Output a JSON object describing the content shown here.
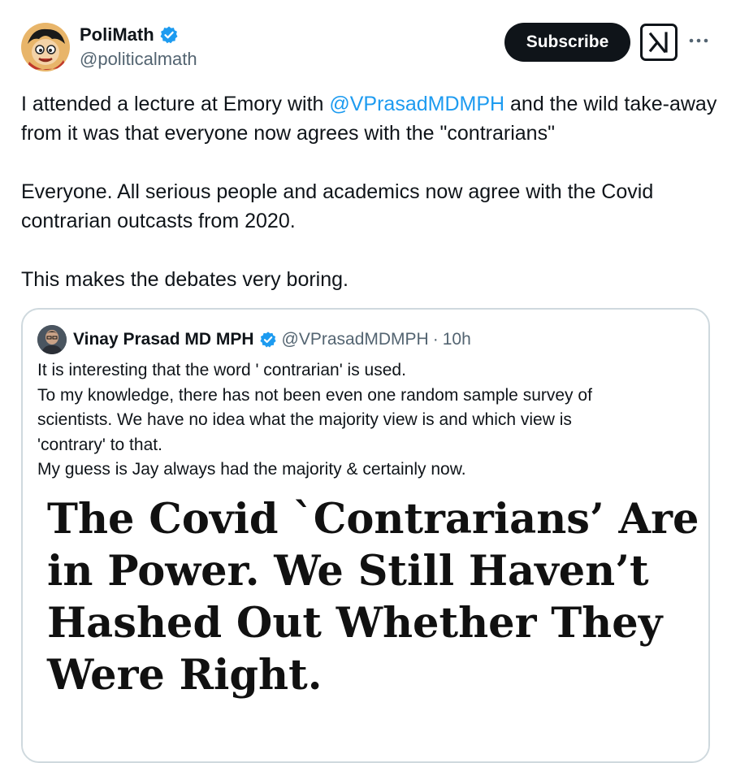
{
  "author": {
    "display_name": "PoliMath",
    "handle": "@politicalmath",
    "verified_icon": "verified-badge-icon"
  },
  "actions": {
    "subscribe_label": "Subscribe",
    "grok_icon": "grok-icon",
    "more_icon": "more-icon"
  },
  "tweet": {
    "para1_before": "I attended a lecture at Emory with ",
    "para1_mention": "@VPrasadMDMPH",
    "para1_after": " and the wild take-away from it was that everyone now agrees with the \"contrarians\"",
    "para2": "Everyone. All serious people and academics now agree with the Covid contrarian outcasts from 2020.",
    "para3": "This makes the debates very boring."
  },
  "quote": {
    "display_name": "Vinay Prasad MD MPH",
    "handle": "@VPrasadMDMPH",
    "separator": "·",
    "time": "10h",
    "lines": [
      "It is interesting that the word ' contrarian' is used.",
      "To my knowledge, there has not been even one random sample survey of",
      "scientists. We have no idea what the majority view is and which view is",
      "'contrary' to that.",
      "My guess is Jay always had the majority & certainly now."
    ],
    "image_headline": [
      "The Covid ˋContrarians’ Are",
      "in Power. We Still Haven’t",
      "Hashed Out Whether They",
      "Were Right."
    ]
  },
  "colors": {
    "link": "#1d9bf0",
    "secondary_text": "#536471",
    "primary_text": "#0f1419",
    "border": "#cfd9de"
  }
}
